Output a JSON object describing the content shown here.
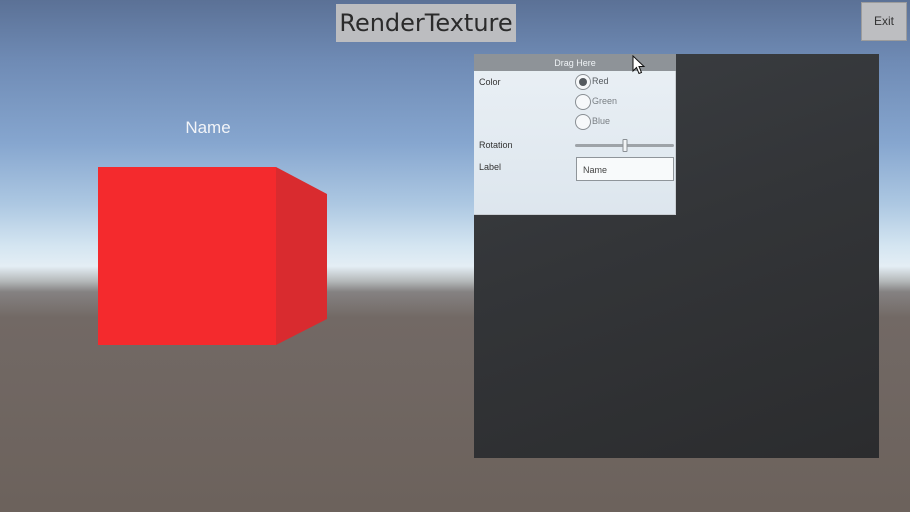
{
  "header": {
    "title": "RenderTexture",
    "exit_label": "Exit"
  },
  "scene": {
    "object_label": "Name",
    "cube_color": "#f42a2d"
  },
  "window": {
    "header_label": "Drag Here",
    "color_label": "Color",
    "color_options": [
      {
        "label": "Red",
        "selected": true
      },
      {
        "label": "Green",
        "selected": false
      },
      {
        "label": "Blue",
        "selected": false
      }
    ],
    "rotation_label": "Rotation",
    "rotation_value": 0.5,
    "label_label": "Label",
    "label_value": "Name"
  },
  "icons": {
    "cursor": "mouse-pointer-icon"
  }
}
